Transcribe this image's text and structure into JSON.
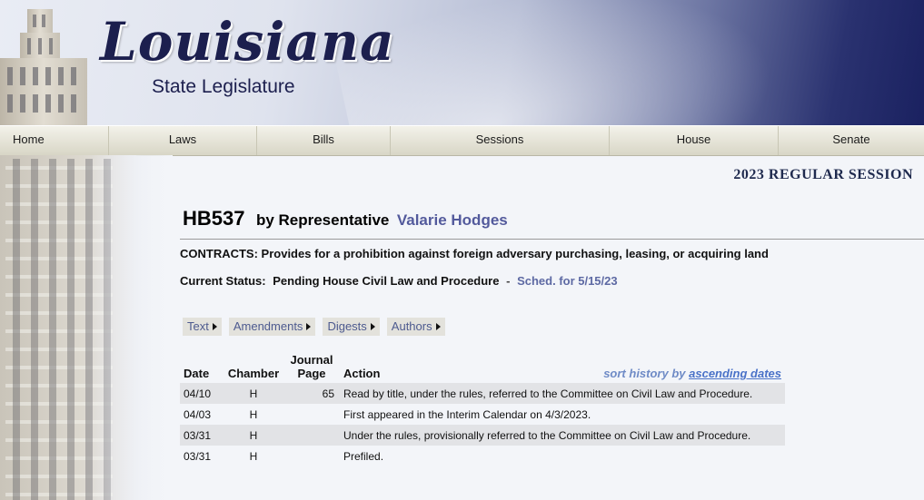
{
  "header": {
    "logo_script": "Louisiana",
    "logo_sub": "State Legislature"
  },
  "nav": {
    "items": [
      {
        "label": "Home"
      },
      {
        "label": "Laws"
      },
      {
        "label": "Bills"
      },
      {
        "label": "Sessions"
      },
      {
        "label": "House"
      },
      {
        "label": "Senate"
      }
    ]
  },
  "session": {
    "title": "2023 REGULAR SESSION"
  },
  "bill": {
    "number": "HB537",
    "by": "by Representative",
    "representative": "Valarie Hodges",
    "summary": "CONTRACTS:  Provides for a prohibition against foreign adversary purchasing, leasing, or acquiring land",
    "status_label": "Current Status:",
    "status_value": "Pending House Civil Law and Procedure",
    "status_sep": "-",
    "sched": "Sched. for 5/15/23"
  },
  "tabs": [
    {
      "label": "Text"
    },
    {
      "label": "Amendments"
    },
    {
      "label": "Digests"
    },
    {
      "label": "Authors"
    }
  ],
  "history": {
    "headers": {
      "date": "Date",
      "chamber": "Chamber",
      "page_line1": "Journal",
      "page_line2": "Page",
      "action": "Action"
    },
    "sort_prefix": "sort history by",
    "sort_link": "ascending dates",
    "rows": [
      {
        "date": "04/10",
        "chamber": "H",
        "page": "65",
        "action": "Read by title, under the rules, referred to the Committee on Civil Law and Procedure."
      },
      {
        "date": "04/03",
        "chamber": "H",
        "page": "",
        "action": "First appeared in the Interim Calendar on 4/3/2023."
      },
      {
        "date": "03/31",
        "chamber": "H",
        "page": "",
        "action": "Under the rules, provisionally referred to the Committee on Civil Law and Procedure."
      },
      {
        "date": "03/31",
        "chamber": "H",
        "page": "",
        "action": "Prefiled."
      }
    ]
  }
}
